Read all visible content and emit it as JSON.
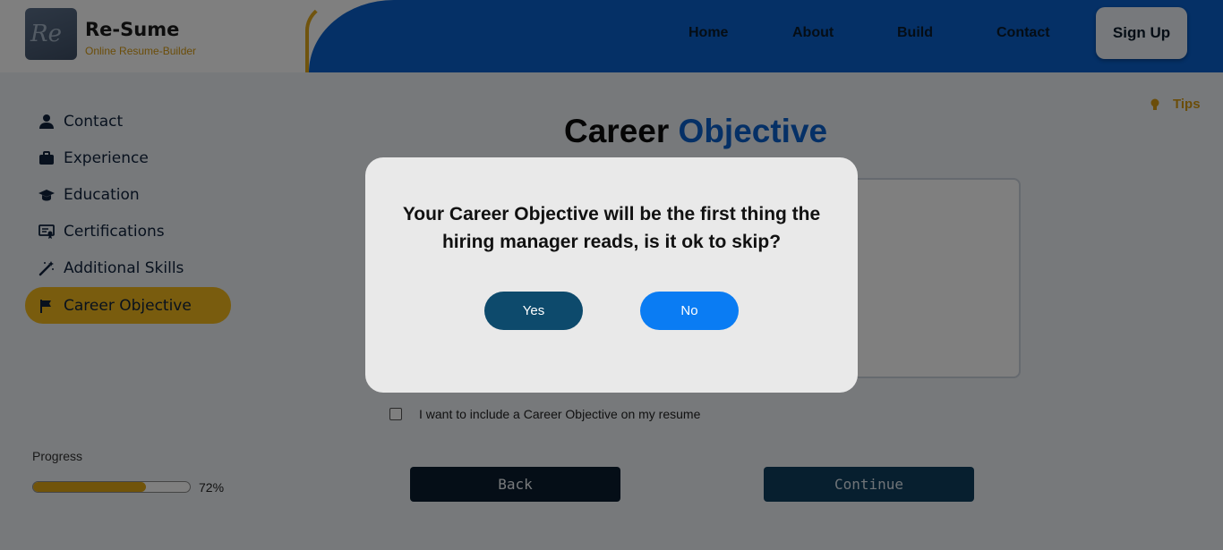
{
  "brand": {
    "name": "Re-Sume",
    "tagline": "Online Resume-Builder",
    "logo_mark": "Re"
  },
  "nav": {
    "items": [
      "Home",
      "About",
      "Build",
      "Contact"
    ],
    "signup_label": "Sign Up"
  },
  "sidebar": {
    "items": [
      {
        "label": "Contact",
        "icon": "user-icon"
      },
      {
        "label": "Experience",
        "icon": "briefcase-icon"
      },
      {
        "label": "Education",
        "icon": "graduation-cap-icon"
      },
      {
        "label": "Certifications",
        "icon": "certificate-icon"
      },
      {
        "label": "Additional Skills",
        "icon": "magic-wand-icon"
      },
      {
        "label": "Career Objective",
        "icon": "flag-icon",
        "active": true
      }
    ],
    "progress_label": "Progress",
    "progress_value": 0.72,
    "progress_text": "72%"
  },
  "main": {
    "tips_label": "Tips",
    "title_part1": "Career",
    "title_part2": "Objective",
    "checkbox_label": "I want to include a Career Objective on my resume",
    "checkbox_checked": false,
    "back_label": "Back",
    "continue_label": "Continue"
  },
  "modal": {
    "line1": "Your Career Objective will be the first thing the",
    "line2": "hiring manager reads, is it ok to skip?",
    "yes_label": "Yes",
    "no_label": "No"
  },
  "colors": {
    "brand_blue": "#0a60cc",
    "accent_gold": "#f2b81c",
    "yes_button": "#0d4a6c",
    "no_button": "#0a7cf3"
  }
}
